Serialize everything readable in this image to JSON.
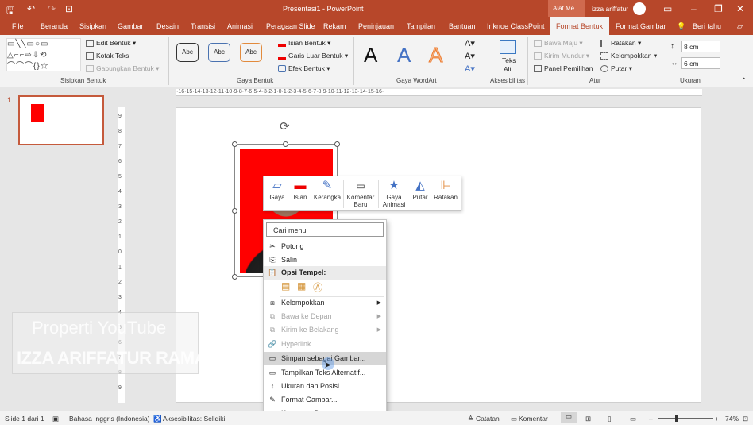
{
  "qat": {
    "save_icon": "save-icon",
    "undo_icon": "undo-icon",
    "redo_icon": "redo-icon",
    "present_icon": "present-icon"
  },
  "title": {
    "text": "Presentasi1  -  PowerPoint",
    "context": "Alat Me...",
    "user": "izza ariffatur"
  },
  "tabs": [
    "File",
    "Beranda",
    "Sisipkan",
    "Gambar",
    "Desain",
    "Transisi",
    "Animasi",
    "Peragaan Slide",
    "Rekam",
    "Peninjauan",
    "Tampilan",
    "Bantuan",
    "Inknoe ClassPoint",
    "Format Bentuk",
    "Format Gambar"
  ],
  "tell_me": "Beri tahu",
  "ribbon": {
    "insert_shapes": {
      "edit": "Edit Bentuk",
      "textbox": "Kotak Teks",
      "merge": "Gabungkan Bentuk",
      "label": "Sisipkan Bentuk"
    },
    "shape_styles": {
      "samples": [
        "Abc",
        "Abc",
        "Abc"
      ],
      "fill": "Isian Bentuk",
      "outline": "Garis Luar Bentuk",
      "effects": "Efek Bentuk",
      "label": "Gaya Bentuk"
    },
    "wordart": {
      "samples": [
        "A",
        "A",
        "A"
      ],
      "label": "Gaya WordArt"
    },
    "accessibility": {
      "alt_text_1": "Teks",
      "alt_text_2": "Alt",
      "label": "Aksesibilitas"
    },
    "arrange": {
      "forward": "Bawa Maju",
      "backward": "Kirim Mundur",
      "pane": "Panel Pemilihan",
      "align": "Ratakan",
      "group": "Kelompokkan",
      "rotate": "Putar",
      "label": "Atur"
    },
    "size": {
      "height": "8 cm",
      "width": "6 cm",
      "label": "Ukuran"
    }
  },
  "slides": [
    {
      "number": "1"
    }
  ],
  "ruler": {
    "h": "·16·15·14·13·12·11·10·9·8·7·6·5·4·3·2·1·0·1·2·3·4·5·6·7·8·9·10·11·12·13·14·15·16·",
    "v": "9 8 7 6 5 4 3 2 1 0 1 2 3 4 5 6 7 8 9"
  },
  "mini_toolbar": [
    "Gaya",
    "Isian",
    "Kerangka",
    "Komentar Baru",
    "Gaya Animasi",
    "Putar",
    "Ratakan"
  ],
  "context_menu": {
    "search_placeholder": "Cari menu",
    "items": [
      {
        "label": "Potong",
        "icon": "cut-icon",
        "state": "normal"
      },
      {
        "label": "Salin",
        "icon": "copy-icon",
        "state": "normal"
      },
      {
        "label": "Opsi Tempel:",
        "icon": "paste-icon",
        "state": "header"
      },
      {
        "label": "Kelompokkan",
        "icon": "group-icon",
        "state": "submenu"
      },
      {
        "label": "Bawa ke Depan",
        "icon": "bring-front-icon",
        "state": "disabled-submenu"
      },
      {
        "label": "Kirim ke Belakang",
        "icon": "send-back-icon",
        "state": "disabled-submenu"
      },
      {
        "label": "Hyperlink...",
        "icon": "link-icon",
        "state": "disabled"
      },
      {
        "label": "Simpan sebagai Gambar...",
        "icon": "save-picture-icon",
        "state": "highlight"
      },
      {
        "label": "Tampilkan Teks Alternatif...",
        "icon": "alt-text-icon",
        "state": "normal"
      },
      {
        "label": "Ukuran dan Posisi...",
        "icon": "size-icon",
        "state": "normal"
      },
      {
        "label": "Format Gambar...",
        "icon": "format-picture-icon",
        "state": "normal"
      },
      {
        "label": "Komentar Baru",
        "icon": "comment-icon",
        "state": "normal"
      }
    ]
  },
  "watermark": {
    "line1": "Properti YouTube",
    "line2": "IZZA ARIFFATUR RAMADHANI"
  },
  "status": {
    "slide": "Slide 1 dari 1",
    "lang": "Bahasa Inggris (Indonesia)",
    "access": "Aksesibilitas: Selidiki",
    "notes": "Catatan",
    "comments": "Komentar",
    "zoom": "74%"
  },
  "colors": {
    "accent": "#b7472a",
    "photo_bg": "#ff0000"
  }
}
